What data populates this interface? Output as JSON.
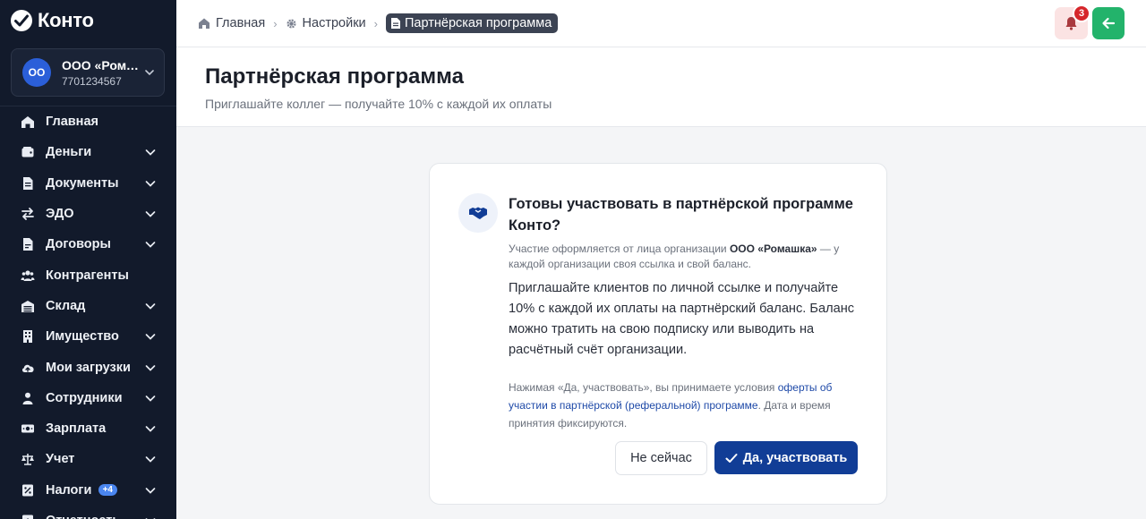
{
  "app": {
    "name": "Конто"
  },
  "org": {
    "initials": "ОО",
    "name": "ООО «Ромашка»",
    "inn": "7701234567"
  },
  "sidebar": {
    "items": [
      {
        "label": "Главная",
        "icon": "home-icon",
        "chevron": false
      },
      {
        "label": "Деньги",
        "icon": "wallet-icon",
        "chevron": true
      },
      {
        "label": "Документы",
        "icon": "document-icon",
        "chevron": true
      },
      {
        "label": "ЭДО",
        "icon": "exchange-icon",
        "chevron": true
      },
      {
        "label": "Договоры",
        "icon": "contract-icon",
        "chevron": true
      },
      {
        "label": "Контрагенты",
        "icon": "users-icon",
        "chevron": false
      },
      {
        "label": "Склад",
        "icon": "warehouse-icon",
        "chevron": true
      },
      {
        "label": "Имущество",
        "icon": "building-icon",
        "chevron": true
      },
      {
        "label": "Мои загрузки",
        "icon": "cloud-upload-icon",
        "chevron": true
      },
      {
        "label": "Сотрудники",
        "icon": "user-icon",
        "chevron": true
      },
      {
        "label": "Зарплата",
        "icon": "money-icon",
        "chevron": true
      },
      {
        "label": "Учет",
        "icon": "scales-icon",
        "chevron": true
      },
      {
        "label": "Налоги",
        "icon": "tax-icon",
        "chevron": true,
        "badge": "+4"
      },
      {
        "label": "Отчетность",
        "icon": "report-icon",
        "chevron": true
      }
    ]
  },
  "breadcrumbs": [
    {
      "label": "Главная",
      "icon": "home-icon"
    },
    {
      "label": "Настройки",
      "icon": "gear-icon"
    },
    {
      "label": "Партнёрская программа",
      "icon": "document-icon"
    }
  ],
  "notifications": {
    "count": "3"
  },
  "page": {
    "title": "Партнёрская программа",
    "subtitle": "Приглашайте коллег — получайте 10% с каждой их оплаты"
  },
  "card": {
    "title": "Готовы участвовать в партнёрской программе Конто?",
    "note_before": "Участие оформляется от лица организации ",
    "note_org": "ООО «Ромашка»",
    "note_after": " — у каждой организации своя ссылка и свой баланс.",
    "text": "Приглашайте клиентов по личной ссылке и получайте 10% с каждой их оплаты на партнёрский баланс. Баланс можно тратить на свою подписку или выводить на расчётный счёт организации.",
    "legal_before": "Нажимая «Да, участвовать», вы принимаете условия ",
    "legal_link": "оферты об участии в партнёрской (реферальной) программе",
    "legal_after": ". Дата и время принятия фиксируются.",
    "cancel_label": "Не сейчас",
    "accept_label": "Да, участвовать"
  },
  "colors": {
    "sidebar_bg": "#121a2b",
    "primary": "#113d96",
    "success": "#23b36b",
    "danger": "#d6262b"
  }
}
